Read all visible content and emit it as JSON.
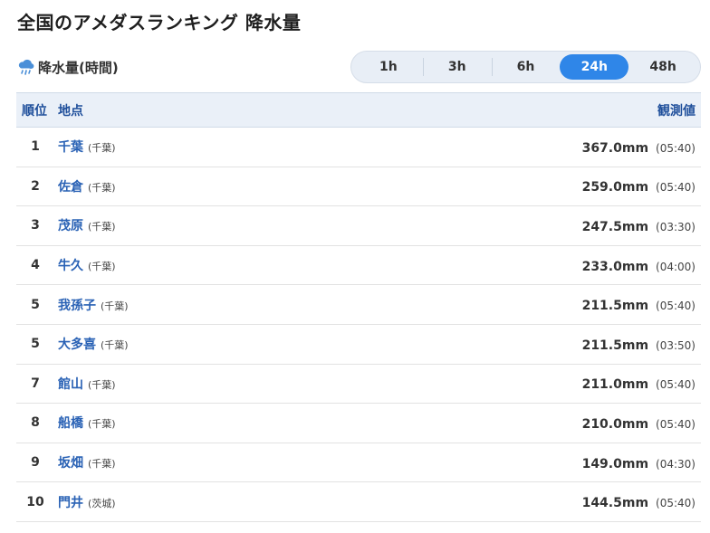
{
  "page": {
    "title": "全国のアメダスランキング 降水量"
  },
  "section": {
    "label": "降水量(時間)",
    "icon": "rain-cloud-icon"
  },
  "tabs": [
    {
      "label": "1h",
      "active": false
    },
    {
      "label": "3h",
      "active": false
    },
    {
      "label": "6h",
      "active": false
    },
    {
      "label": "24h",
      "active": true
    },
    {
      "label": "48h",
      "active": false
    }
  ],
  "table": {
    "headers": {
      "rank": "順位",
      "location": "地点",
      "value": "観測値"
    },
    "rows": [
      {
        "rank": "1",
        "name": "千葉",
        "pref": "(千葉)",
        "amount": "367.0mm",
        "time": "(05:40)"
      },
      {
        "rank": "2",
        "name": "佐倉",
        "pref": "(千葉)",
        "amount": "259.0mm",
        "time": "(05:40)"
      },
      {
        "rank": "3",
        "name": "茂原",
        "pref": "(千葉)",
        "amount": "247.5mm",
        "time": "(03:30)"
      },
      {
        "rank": "4",
        "name": "牛久",
        "pref": "(千葉)",
        "amount": "233.0mm",
        "time": "(04:00)"
      },
      {
        "rank": "5",
        "name": "我孫子",
        "pref": "(千葉)",
        "amount": "211.5mm",
        "time": "(05:40)"
      },
      {
        "rank": "5",
        "name": "大多喜",
        "pref": "(千葉)",
        "amount": "211.5mm",
        "time": "(03:50)"
      },
      {
        "rank": "7",
        "name": "館山",
        "pref": "(千葉)",
        "amount": "211.0mm",
        "time": "(05:40)"
      },
      {
        "rank": "8",
        "name": "船橋",
        "pref": "(千葉)",
        "amount": "210.0mm",
        "time": "(05:40)"
      },
      {
        "rank": "9",
        "name": "坂畑",
        "pref": "(千葉)",
        "amount": "149.0mm",
        "time": "(04:30)"
      },
      {
        "rank": "10",
        "name": "門井",
        "pref": "(茨城)",
        "amount": "144.5mm",
        "time": "(05:40)"
      }
    ]
  },
  "colors": {
    "accent": "#2f86e8",
    "link": "#2a62b5",
    "header_text": "#1f4f9b",
    "header_bg": "#eaf0f8"
  }
}
